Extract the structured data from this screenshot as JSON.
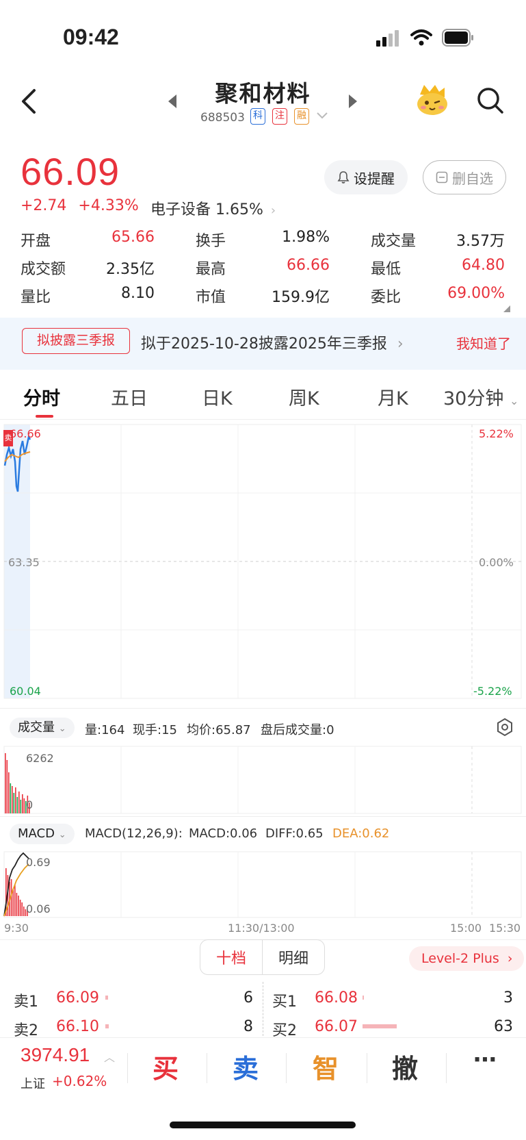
{
  "status_bar": {
    "time": "09:42"
  },
  "nav": {
    "stock_name": "聚和材料",
    "stock_code": "688503",
    "tags": [
      "科",
      "注",
      "融"
    ]
  },
  "quote": {
    "price": "66.09",
    "change": "+2.74",
    "change_pct": "+4.33%",
    "sector": "电子设备 1.65%",
    "alert_label": "设提醒",
    "remove_label": "删自选"
  },
  "stats": [
    {
      "label": "开盘",
      "value": "65.66",
      "color": "red"
    },
    {
      "label": "换手",
      "value": "1.98%",
      "color": "dark"
    },
    {
      "label": "成交量",
      "value": "3.57万",
      "color": "dark"
    },
    {
      "label": "成交额",
      "value": "2.35亿",
      "color": "dark"
    },
    {
      "label": "最高",
      "value": "66.66",
      "color": "red"
    },
    {
      "label": "最低",
      "value": "64.80",
      "color": "red"
    },
    {
      "label": "量比",
      "value": "8.10",
      "color": "dark"
    },
    {
      "label": "市值",
      "value": "159.9亿",
      "color": "dark"
    },
    {
      "label": "委比",
      "value": "69.00%",
      "color": "red"
    }
  ],
  "banner": {
    "tag": "拟披露三季报",
    "text": "拟于2025-10-28披露2025年三季报",
    "dismiss": "我知道了"
  },
  "tabs": [
    "分时",
    "五日",
    "日K",
    "周K",
    "月K",
    "30分钟"
  ],
  "intraday": {
    "price_high": "66.66",
    "price_mid": "63.35",
    "price_low": "60.04",
    "pct_high": "5.22%",
    "pct_mid": "0.00%",
    "pct_low": "-5.22%",
    "sell_marker": "卖"
  },
  "volume_panel": {
    "chip": "成交量",
    "info": [
      "量:164",
      "现手:15",
      "均价:65.87",
      "盘后成交量:0"
    ],
    "max_label": "6262",
    "zero_label": "0"
  },
  "macd_panel": {
    "chip": "MACD",
    "params": "MACD(12,26,9):",
    "macd": "MACD:0.06",
    "diff": "DIFF:0.65",
    "dea": "DEA:0.62",
    "top_label": "0.69",
    "bottom_label": "0.06"
  },
  "time_axis": {
    "start": "9:30",
    "mid": "11:30/13:00",
    "t1500": "15:00",
    "t1530": "15:30"
  },
  "order_book": {
    "seg_left": "十档",
    "seg_right": "明细",
    "level2": "Level-2 Plus",
    "sell": [
      {
        "label": "卖1",
        "price": "66.09",
        "qty": "6"
      },
      {
        "label": "卖2",
        "price": "66.10",
        "qty": "8"
      }
    ],
    "buy": [
      {
        "label": "买1",
        "price": "66.08",
        "qty": "3"
      },
      {
        "label": "买2",
        "price": "66.07",
        "qty": "63"
      }
    ]
  },
  "index": {
    "value": "3974.91",
    "name": "上证",
    "change": "+0.62%"
  },
  "actions": {
    "buy": "买",
    "sell": "卖",
    "smart": "智",
    "cancel": "撤",
    "more": "⋯"
  },
  "colors": {
    "up": "#e8323c",
    "down": "#1aa34a",
    "accent_blue": "#2a6ed8",
    "accent_orange": "#e8912a"
  },
  "icons": [
    "back-icon",
    "prev-stock-icon",
    "next-stock-icon",
    "mascot-icon",
    "search-icon",
    "bell-icon",
    "settings-icon"
  ]
}
